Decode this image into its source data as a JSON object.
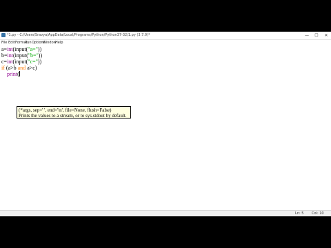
{
  "window": {
    "title": "*1.py - C:/Users/Sravya/AppData/Local/Programs/Python/Python37-32/1.py (3.7.0)*",
    "controls": {
      "minimize": "—",
      "maximize": "☐",
      "close": "✕"
    }
  },
  "menu": [
    "File",
    "Edit",
    "Format",
    "Run",
    "Options",
    "Window",
    "Help"
  ],
  "code": {
    "line1": {
      "var": "a=",
      "func": "int",
      "inner": "(input(",
      "str": "\"a=\"",
      "close": "))"
    },
    "line2": {
      "var": "b=",
      "func": "int",
      "inner": "(input(",
      "str": "\"b=\"",
      "close": "))"
    },
    "line3": {
      "var": "c=",
      "func": "int",
      "inner": "(input(",
      "str": "\"c=\"",
      "close": "))"
    },
    "line4": {
      "kw1": "if",
      "cond1": " (a>b ",
      "kw2": "and",
      "cond2": " a>c)"
    },
    "line5": {
      "indent": "    ",
      "func": "print",
      "open": "("
    }
  },
  "calltip": {
    "signature": "(*args, sep=' ', end='\\n', file=None, flush=False)",
    "doc": "Prints the values to a stream, or to sys.stdout by default."
  },
  "status": {
    "line": "Ln: 5",
    "col": "Col: 10"
  }
}
